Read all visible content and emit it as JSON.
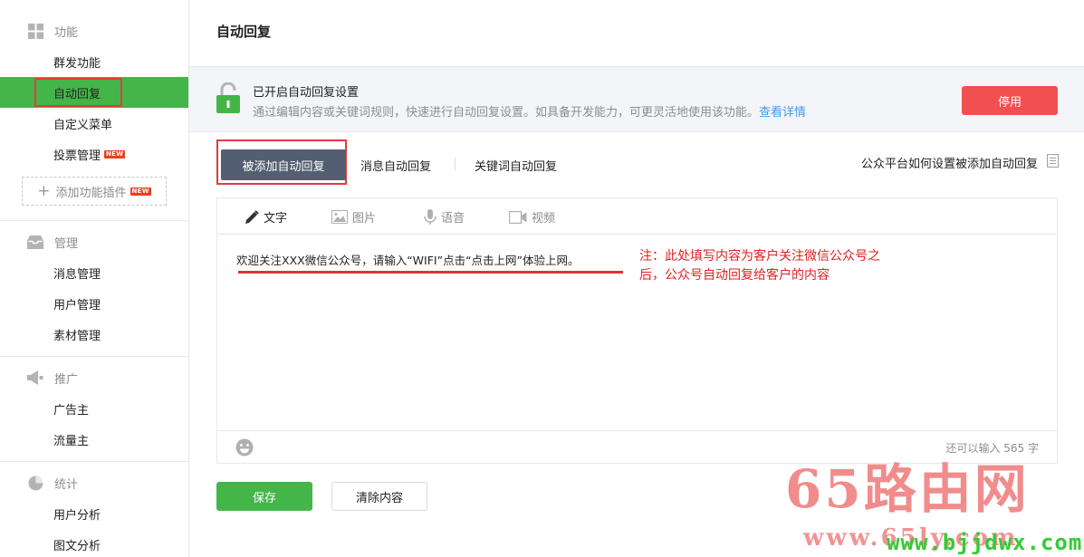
{
  "colors": {
    "accent_green": "#44b549",
    "danger_red": "#f05050",
    "annotation_red": "#e02020",
    "tab_dark": "#535e72",
    "link_blue": "#459ae9"
  },
  "sidebar": {
    "sections": [
      {
        "icon": "grid-icon",
        "title": "功能",
        "items": [
          {
            "label": "群发功能"
          },
          {
            "label": "自动回复",
            "active": true
          },
          {
            "label": "自定义菜单"
          },
          {
            "label": "投票管理",
            "badge": "NEW"
          }
        ],
        "add_plugin": {
          "label": "添加功能插件",
          "badge": "NEW"
        }
      },
      {
        "icon": "inbox-icon",
        "title": "管理",
        "items": [
          {
            "label": "消息管理"
          },
          {
            "label": "用户管理"
          },
          {
            "label": "素材管理"
          }
        ]
      },
      {
        "icon": "megaphone-icon",
        "title": "推广",
        "items": [
          {
            "label": "广告主"
          },
          {
            "label": "流量主"
          }
        ]
      },
      {
        "icon": "pie-chart-icon",
        "title": "统计",
        "items": [
          {
            "label": "用户分析"
          },
          {
            "label": "图文分析"
          }
        ]
      }
    ]
  },
  "main": {
    "title": "自动回复",
    "banner": {
      "title": "已开启自动回复设置",
      "desc": "通过编辑内容或关键词规则，快速进行自动回复设置。如具备开发能力，可更灵活地使用该功能。",
      "link": "查看详情",
      "disable_button": "停用"
    },
    "tabs": [
      {
        "label": "被添加自动回复",
        "active": true
      },
      {
        "label": "消息自动回复"
      },
      {
        "label": "关键词自动回复"
      }
    ],
    "help_link": "公众平台如何设置被添加自动回复",
    "editor": {
      "types": [
        {
          "label": "文字",
          "icon": "pencil-icon",
          "active": true
        },
        {
          "label": "图片",
          "icon": "image-icon"
        },
        {
          "label": "语音",
          "icon": "microphone-icon"
        },
        {
          "label": "视频",
          "icon": "video-icon"
        }
      ],
      "content": "欢迎关注XXX微信公众号，请输入“WIFI”点击“点击上网”体验上网。",
      "annotation": "注：此处填写内容为客户关注微信公众号之后，公众号自动回复给客户的内容",
      "counter": "还可以输入 565 字"
    },
    "save_button": "保存",
    "clear_button": "清除内容"
  },
  "watermark": {
    "big": "65路由网",
    "small": "www.65ly.com",
    "green": "www.bjjdwx.com"
  }
}
